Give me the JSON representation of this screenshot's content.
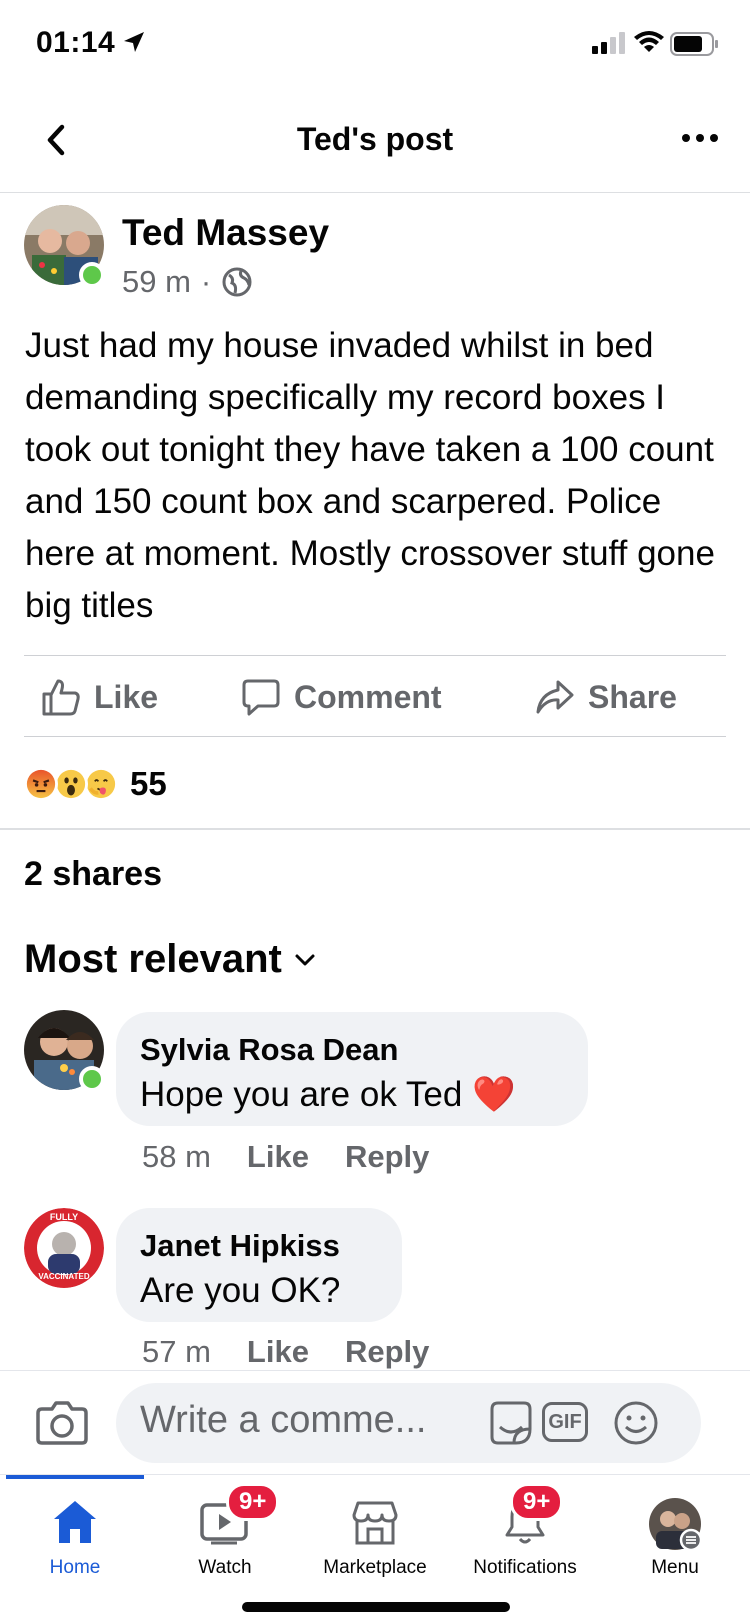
{
  "status_bar": {
    "time": "01:14"
  },
  "header": {
    "title": "Ted's post"
  },
  "post": {
    "author": "Ted Massey",
    "time": "59 m",
    "separator": "·",
    "text": "Just had my house invaded whilst in bed demanding specifically my record boxes I took out tonight they have taken a 100 count and 150 count box and scarpered. Police here at moment. Mostly crossover stuff gone big titles"
  },
  "actions": {
    "like": "Like",
    "comment": "Comment",
    "share": "Share"
  },
  "reactions": {
    "count": "55",
    "types": [
      "angry",
      "wow",
      "care"
    ]
  },
  "shares": "2 shares",
  "sort": {
    "label": "Most relevant"
  },
  "comments": [
    {
      "name": "Sylvia Rosa Dean",
      "text": "Hope you are ok Ted ",
      "emoji": "❤️",
      "time": "58 m",
      "like": "Like",
      "reply": "Reply"
    },
    {
      "name": "Janet Hipkiss",
      "text": "Are you OK?",
      "time": "57 m",
      "like": "Like",
      "reply": "Reply",
      "avatar_badge_top": "FULLY",
      "avatar_badge_bottom": "VACCINATED"
    }
  ],
  "composer": {
    "placeholder": "Write a comme...",
    "gif": "GIF"
  },
  "tabs": [
    {
      "label": "Home",
      "icon": "home-icon",
      "active": true
    },
    {
      "label": "Watch",
      "icon": "watch-icon",
      "badge": "9+"
    },
    {
      "label": "Marketplace",
      "icon": "marketplace-icon"
    },
    {
      "label": "Notifications",
      "icon": "bell-icon",
      "badge": "9+"
    },
    {
      "label": "Menu",
      "icon": "menu-avatar-icon"
    }
  ],
  "colors": {
    "accent": "#1b5bd6",
    "online": "#5ec84a",
    "badge": "#e41e3f",
    "muted": "#65676b",
    "bubble": "#f0f2f5"
  }
}
